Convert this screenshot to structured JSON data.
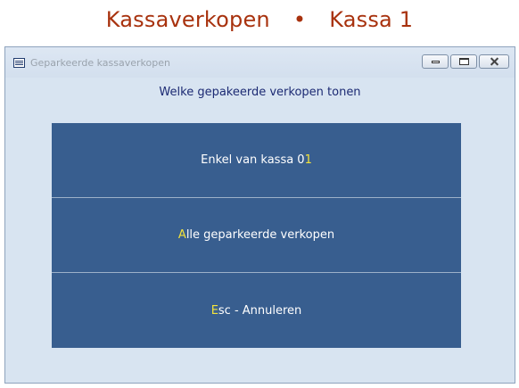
{
  "page_header": {
    "left": "Kassaverkopen",
    "separator": "•",
    "right": "Kassa 1"
  },
  "window": {
    "title": "Geparkeerde kassaverkopen",
    "icon": "window-list-icon",
    "controls": [
      "minimize",
      "restore",
      "close"
    ]
  },
  "dialog": {
    "prompt": "Welke gepakeerde verkopen tonen",
    "options": [
      {
        "pre": "Enkel van kassa 0",
        "hotkey": "1",
        "post": ""
      },
      {
        "pre": "",
        "hotkey": "A",
        "post": "lle geparkeerde verkopen"
      },
      {
        "pre": "",
        "hotkey": "E",
        "post": "sc - Annuleren"
      }
    ]
  },
  "colors": {
    "header_text": "#a8320e",
    "button_bg": "#385e8f",
    "hotkey": "#f3e33a",
    "prompt_text": "#1c2a73",
    "window_bg": "#d8e4f1"
  }
}
